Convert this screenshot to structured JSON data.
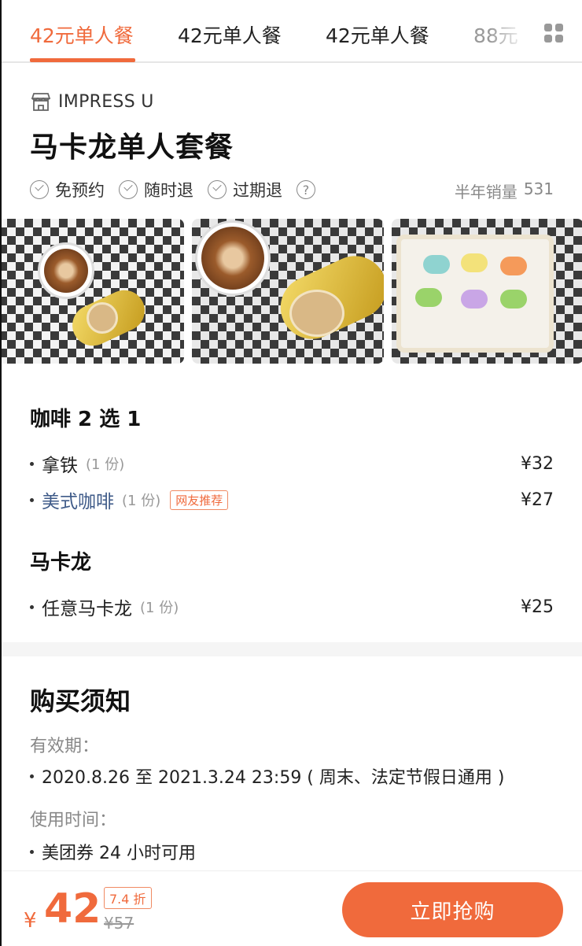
{
  "tabs": [
    {
      "label": "42元单人餐",
      "active": true
    },
    {
      "label": "42元单人餐",
      "active": false
    },
    {
      "label": "42元单人餐",
      "active": false
    },
    {
      "label": "88元",
      "active": false
    }
  ],
  "shop": {
    "icon": "store-icon",
    "name": "IMPRESS U"
  },
  "deal": {
    "title": "马卡龙单人套餐",
    "tags": [
      "免预约",
      "随时退",
      "过期退"
    ],
    "sales_label": "半年销量",
    "sales_count": "531"
  },
  "menu": {
    "sections": [
      {
        "title": "咖啡 2 选 1",
        "items": [
          {
            "name": "拿铁",
            "qty": "(1 份)",
            "price": "¥32"
          },
          {
            "name": "美式咖啡",
            "qty": "(1 份)",
            "badge": "网友推荐",
            "price": "¥27"
          }
        ]
      },
      {
        "title": "马卡龙",
        "items": [
          {
            "name": "任意马卡龙",
            "qty": "(1 份)",
            "price": "¥25"
          }
        ]
      }
    ]
  },
  "notice": {
    "title": "购买须知",
    "validity_label": "有效期：",
    "validity_value": "2020.8.26 至 2021.3.24 23:59 ( 周末、法定节假日通用 )",
    "usage_label": "使用时间：",
    "usage_value": "美团券 24 小时可用"
  },
  "bottom": {
    "currency": "¥",
    "price": "42",
    "discount": "7.4 折",
    "original_price": "¥57",
    "buy_label": "立即抢购"
  },
  "colors": {
    "accent": "#f06a3c",
    "link": "#3e5a88"
  }
}
